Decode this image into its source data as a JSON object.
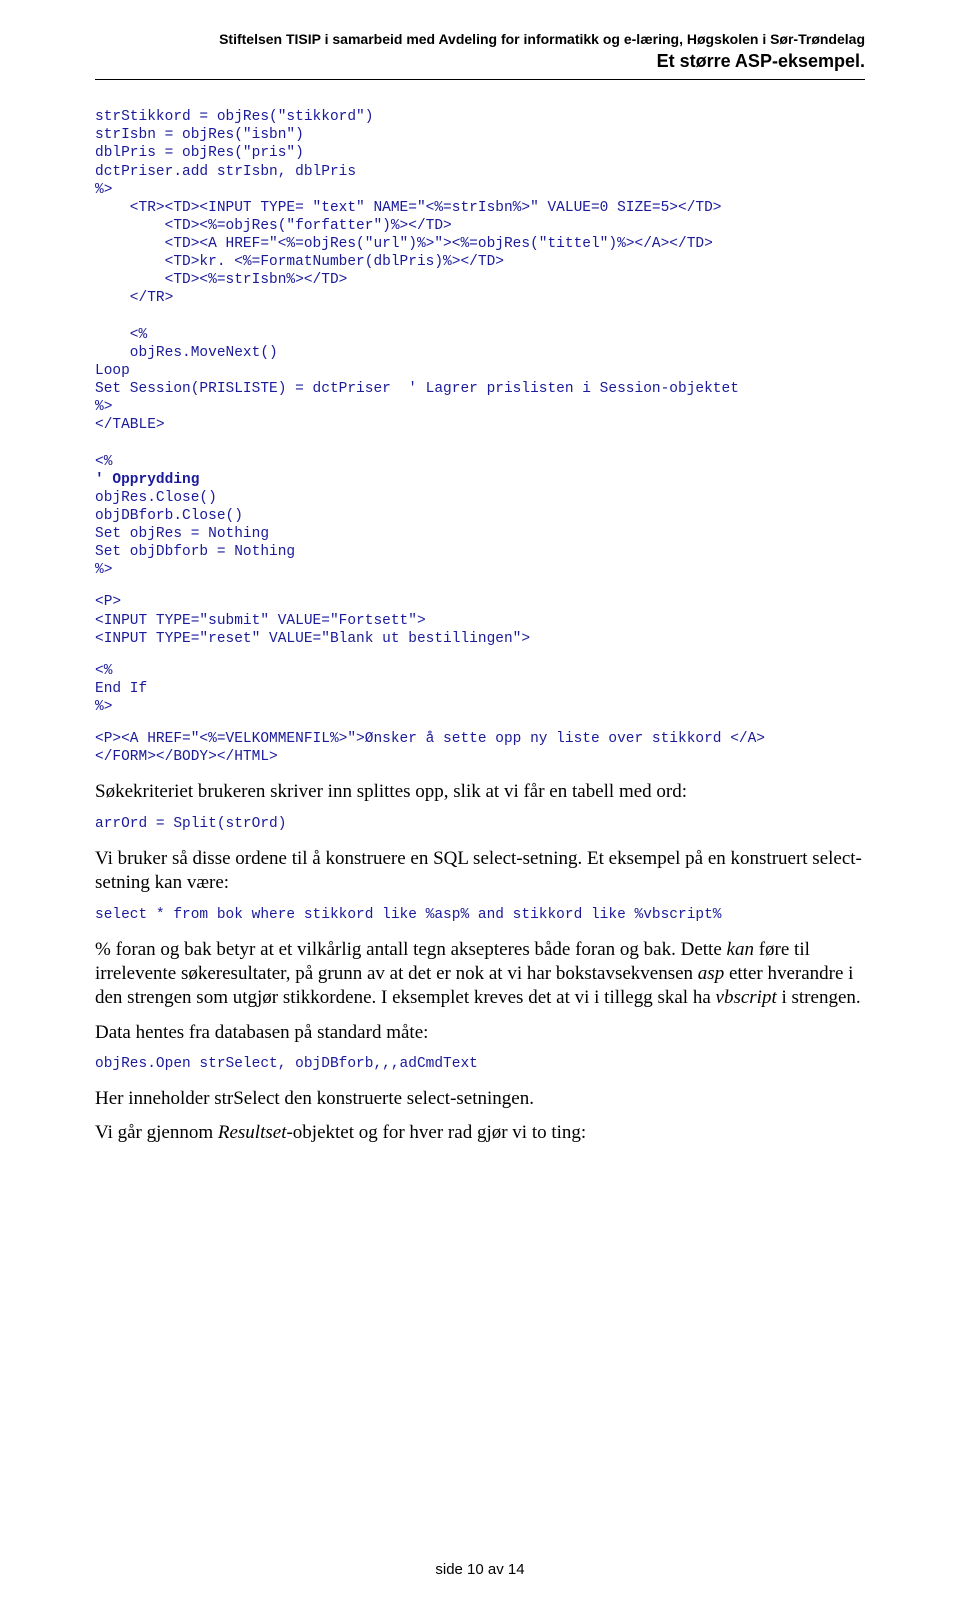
{
  "header": {
    "line1": "Stiftelsen TISIP i samarbeid med Avdeling for informatikk og e-læring, Høgskolen i Sør-Trøndelag",
    "line2": "Et større ASP-eksempel."
  },
  "code": {
    "block1_l1": "strStikkord = objRes(\"stikkord\")",
    "block1_l2": "strIsbn = objRes(\"isbn\")",
    "block1_l3": "dblPris = objRes(\"pris\")",
    "block1_l4": "dctPriser.add strIsbn, dblPris",
    "block1_l5": "%>",
    "block1_l6": "    <TR><TD><INPUT TYPE= \"text\" NAME=\"<%=strIsbn%>\" VALUE=0 SIZE=5></TD>",
    "block1_l7": "        <TD><%=objRes(\"forfatter\")%></TD>",
    "block1_l8": "        <TD><A HREF=\"<%=objRes(\"url\")%>\"><%=objRes(\"tittel\")%></A></TD>",
    "block1_l9": "        <TD>kr. <%=FormatNumber(dblPris)%></TD>",
    "block1_l10": "        <TD><%=strIsbn%></TD>",
    "block1_l11": "    </TR>",
    "block1_blank1": "",
    "block1_l12": "    <%",
    "block1_l13": "    objRes.MoveNext()",
    "block1_l14": "Loop",
    "block1_l15": "Set Session(PRISLISTE) = dctPriser  ' Lagrer prislisten i Session-objektet",
    "block1_l16": "%>",
    "block1_l17": "</TABLE>",
    "block1_blank2": "",
    "block1_l18": "<%",
    "block1_l19a": "' Opprydding",
    "block1_l19b": "objRes.Close()",
    "block1_l20": "objDBforb.Close()",
    "block1_l21": "Set objRes = Nothing",
    "block1_l22": "Set objDbforb = Nothing",
    "block1_l23": "%>",
    "block2_l1": "<P>",
    "block2_l2": "<INPUT TYPE=\"submit\" VALUE=\"Fortsett\">",
    "block2_l3": "<INPUT TYPE=\"reset\" VALUE=\"Blank ut bestillingen\">",
    "block3_l1": "<%",
    "block3_l2": "End If",
    "block3_l3": "%>",
    "block4_l1": "<P><A HREF=\"<%=VELKOMMENFIL%>\">Ønsker å sette opp ny liste over stikkord </A>",
    "block4_l2": "</FORM></BODY></HTML>",
    "arrord": "arrOrd = Split(strOrd)",
    "select": "select * from bok where stikkord like %asp% and stikkord like %vbscript%",
    "objresopen": "objRes.Open strSelect, objDBforb,,,adCmdText"
  },
  "body": {
    "p1": "Søkekriteriet brukeren skriver inn splittes opp, slik at vi får en tabell med ord:",
    "p2": "Vi bruker så disse ordene til å konstruere en SQL select-setning. Et eksempel på en konstruert select-setning kan være:",
    "p3a": "% foran og bak betyr at et vilkårlig antall tegn aksepteres både foran og bak. Dette ",
    "p3b": "kan",
    "p3c": " føre til irrelevente søkeresultater, på grunn av at det er nok at vi har bokstavsekvensen ",
    "p3d": "asp",
    "p3e": " etter hverandre i den strengen som utgjør stikkordene. I eksemplet kreves det at vi i tillegg skal ha ",
    "p3f": "vbscript",
    "p3g": " i strengen.",
    "p4": "Data hentes fra databasen på standard måte:",
    "p5": "Her inneholder strSelect den konstruerte select-setningen.",
    "p6a": "Vi går gjennom ",
    "p6b": "Resultset",
    "p6c": "-objektet og for hver rad gjør vi to ting:"
  },
  "footer": {
    "text": "side 10 av 14"
  }
}
